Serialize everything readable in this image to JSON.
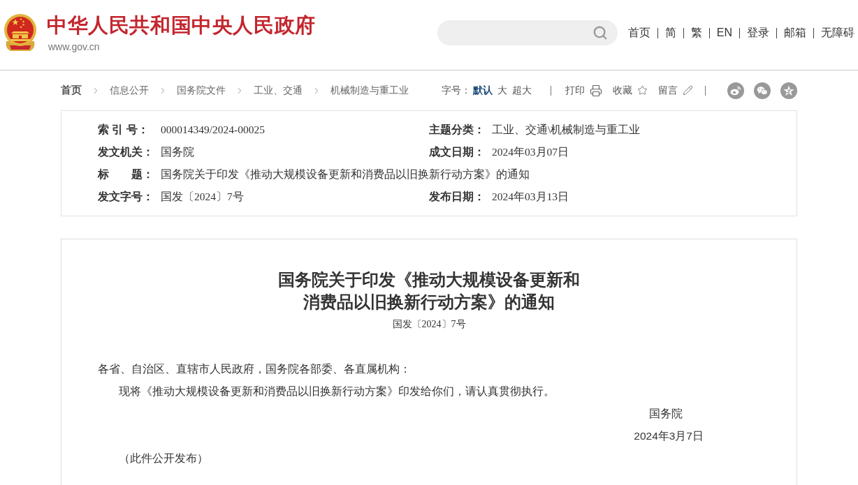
{
  "header": {
    "site_title": "中华人民共和国中央人民政府",
    "site_url": "www.gov.cn",
    "nav_links": [
      "首页",
      "简",
      "繁",
      "EN",
      "登录",
      "邮箱",
      "无障碍"
    ]
  },
  "breadcrumb": [
    {
      "label": "首页",
      "kind": "home"
    },
    {
      "label": "信息公开",
      "kind": "link"
    },
    {
      "label": "国务院文件",
      "kind": "link"
    },
    {
      "label": "工业、交通",
      "kind": "link"
    },
    {
      "label": "机械制造与重工业",
      "kind": "link"
    }
  ],
  "toolbar": {
    "font_size": {
      "label": "字号：",
      "options": [
        {
          "label": "默认",
          "selected": true
        },
        {
          "label": "大",
          "selected": false
        },
        {
          "label": "超大",
          "selected": false
        }
      ]
    },
    "actions": [
      {
        "kind": "print",
        "label": "打印"
      },
      {
        "kind": "favorite",
        "label": "收藏"
      },
      {
        "kind": "comment",
        "label": "留言"
      }
    ]
  },
  "metadata": {
    "rows": [
      {
        "fields": [
          {
            "label": "索 引 号：",
            "value": "000014349/2024-00025"
          },
          {
            "label": "主题分类：",
            "value": "工业、交通\\机械制造与重工业"
          }
        ]
      },
      {
        "fields": [
          {
            "label": "发文机关：",
            "value": "国务院"
          },
          {
            "label": "成文日期：",
            "value": "2024年03月07日"
          }
        ]
      },
      {
        "fields": [
          {
            "label": "标　　题：",
            "value": "国务院关于印发《推动大规模设备更新和消费品以旧换新行动方案》的通知"
          }
        ]
      },
      {
        "fields": [
          {
            "label": "发文字号：",
            "value": "国发〔2024〕7号"
          },
          {
            "label": "发布日期：",
            "value": "2024年03月13日"
          }
        ]
      }
    ]
  },
  "document": {
    "title": "国务院关于印发《推动大规模设备更新和消费品以旧换新行动方案》的通知",
    "doc_number": "国发〔2024〕7号",
    "salutation": "各省、自治区、直辖市人民政府，国务院各部委、各直属机构：",
    "paragraphs": [
      "现将《推动大规模设备更新和消费品以旧换新行动方案》印发给你们，请认真贯彻执行。"
    ],
    "signature": {
      "issuer": "国务院",
      "date": "2024年3月7日"
    },
    "note": "（此件公开发布）"
  }
}
